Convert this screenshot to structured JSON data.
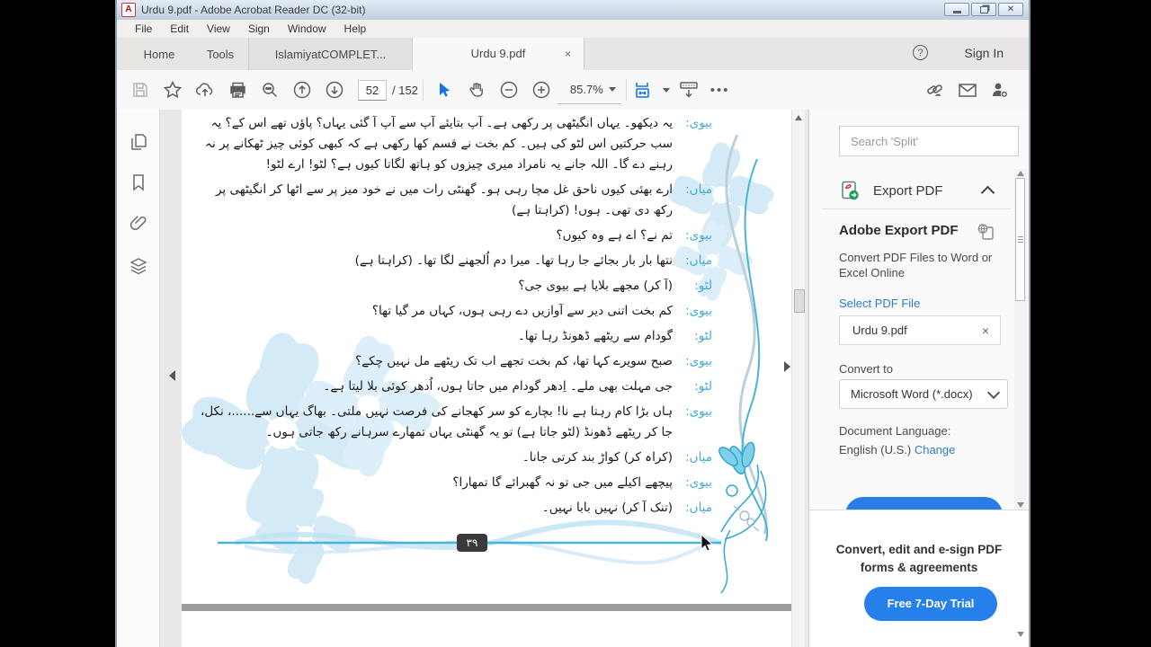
{
  "window": {
    "title": "Urdu 9.pdf - Adobe Acrobat Reader DC (32-bit)",
    "app_icon": "adobe-acrobat-icon"
  },
  "menu": {
    "items": [
      "File",
      "Edit",
      "View",
      "Sign",
      "Window",
      "Help"
    ]
  },
  "tabs": {
    "home": "Home",
    "tools": "Tools",
    "doc_tabs": [
      {
        "label": "IslamiyatCOMPLET...",
        "active": false
      },
      {
        "label": "Urdu 9.pdf",
        "active": true,
        "close": "×"
      }
    ],
    "sign_in": "Sign In",
    "help_glyph": "?"
  },
  "toolbar": {
    "page_current": "52",
    "page_total": "/ 152",
    "zoom_level": "85.7%",
    "overflow_dots": "•••"
  },
  "document": {
    "page_number_badge": "۳۹",
    "dialogue": [
      {
        "speaker": "بیوی:",
        "text": "یہ دیکھو۔ یہاں انگیٹھی پر رکھی ہے۔ آپ بتایئے آپ سے آپ آ گئی یہاں؟ پاؤں تھے اس کے؟ یہ سب حرکتیں اس لٹو کی ہیں۔ کم بخت نے قسم کھا رکھی ہے کہ کبھی کوئی چیز ٹھکانے پر نہ رہنے دے گا۔ اللہ جانے یہ نامراد میری چیزوں کو ہاتھ لگاتا کیوں ہے؟ لٹو! ارے لٹو!"
      },
      {
        "speaker": "میاں:",
        "text": "ارے بھئی کیوں ناحق غل مچا رہی ہو۔ گھنٹی رات میں نے خود میز پر سے اٹھا کر انگیٹھی پر رکھ دی تھی۔ ہوں! (کراہتا ہے)"
      },
      {
        "speaker": "بیوی:",
        "text": "تم نے؟ اے ہے وہ کیوں؟"
      },
      {
        "speaker": "میاں:",
        "text": "نتھا بار بار بجائے جا رہا تھا۔ میرا دم اُلجھنے لگا تھا۔ (کراہتا ہے)"
      },
      {
        "speaker": "لٹو:",
        "text": "(آ کر) مجھے بلایا ہے بیوی جی؟"
      },
      {
        "speaker": "بیوی:",
        "text": "کم بخت اتنی دیر سے آوازیں دے رہی ہوں، کہاں مر گیا تھا؟"
      },
      {
        "speaker": "لٹو:",
        "text": "گودام سے ریٹھے ڈھونڈ رہا تھا۔"
      },
      {
        "speaker": "بیوی:",
        "text": "صبح سویرے کہا تھا، کم بخت تجھے اب تک ریٹھے مل نہیں چکے؟"
      },
      {
        "speaker": "لٹو:",
        "text": "جی مہلت بھی ملے۔ اِدھر گودام میں جاتا ہوں، اُدھر کوئی بلا لیتا ہے۔"
      },
      {
        "speaker": "بیوی:",
        "text": "ہاں بڑا کام رہتا ہے نا! بچارے کو سر کھجانے کی فرصت نہیں ملتی۔ بھاگ یہاں سے......، نکل، جا کر ریٹھے ڈھونڈ (لٹو جاتا ہے) تو یہ گھنٹی یہاں تمھارے سرہانے رکھ جاتی ہوں۔"
      },
      {
        "speaker": "میاں:",
        "text": "(کراہ کر) کواڑ بند کرتی جانا۔"
      },
      {
        "speaker": "بیوی:",
        "text": "پیچھے اکیلے میں جی تو نہ گھبرائے گا تمھارا؟"
      },
      {
        "speaker": "میاں:",
        "text": "(تنک آ کر) نہیں بابا نہیں۔"
      }
    ]
  },
  "right_panel": {
    "search_placeholder": "Search 'Split'",
    "export_pdf_header": "Export PDF",
    "adobe_export": {
      "title": "Adobe Export PDF",
      "subtitle": "Convert PDF Files to Word or Excel Online",
      "select_label": "Select PDF File",
      "file_name": "Urdu 9.pdf",
      "file_close": "×",
      "convert_to_label": "Convert to",
      "convert_format": "Microsoft Word (*.docx)",
      "doc_lang_label": "Document Language:",
      "doc_lang_value": "English (U.S.)",
      "change_link": "Change"
    },
    "promo": {
      "line1": "Convert, edit and e-sign PDF",
      "line2": "forms & agreements",
      "cta": "Free 7-Day Trial"
    }
  },
  "colors": {
    "accent_blue": "#1473e6",
    "cta_blue": "#2680eb",
    "link_blue": "#2d7cc2",
    "speaker_teal": "#42a9cf",
    "flower_blue": "#d4eaf7",
    "ornament_teal": "#2fa7d1",
    "badge_dark": "#3a3a3a"
  }
}
